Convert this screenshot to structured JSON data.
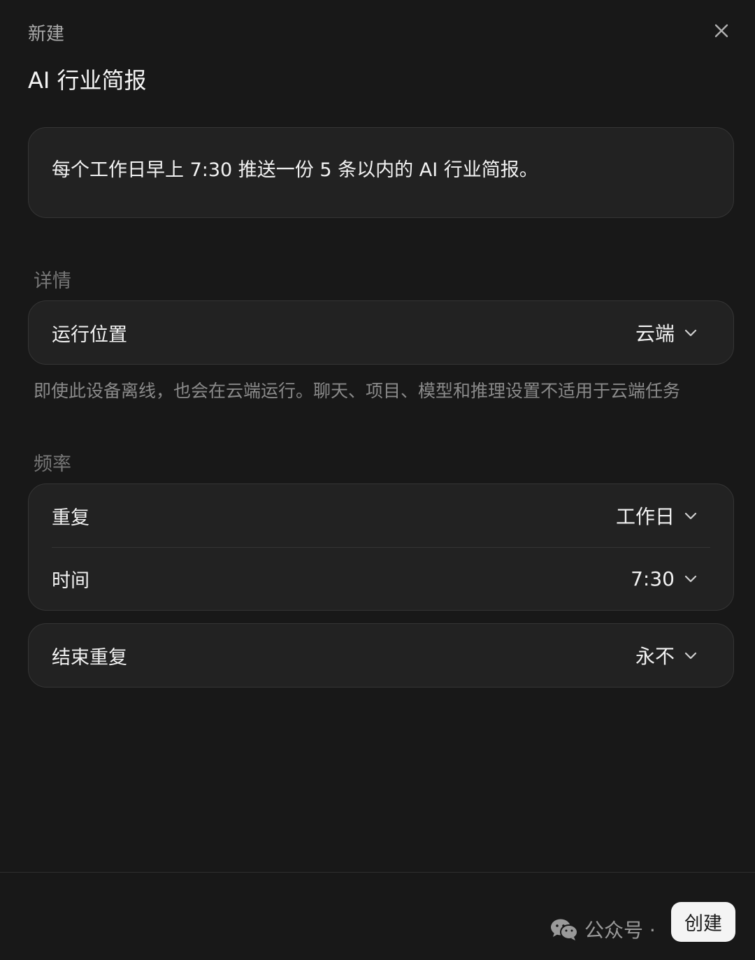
{
  "header": {
    "label": "新建",
    "close_icon": "close-icon"
  },
  "task": {
    "title": "AI 行业简报",
    "prompt": "每个工作日早上 7:30 推送一份 5 条以内的 AI 行业简报。"
  },
  "details": {
    "section_label": "详情",
    "location_label": "运行位置",
    "location_value": "云端",
    "hint": "即使此设备离线，也会在云端运行。聊天、项目、模型和推理设置不适用于云端任务"
  },
  "frequency": {
    "section_label": "频率",
    "repeat_label": "重复",
    "repeat_value": "工作日",
    "time_label": "时间",
    "time_value": "7:30",
    "end_label": "结束重复",
    "end_value": "永不"
  },
  "footer": {
    "watermark_text": "公众号 ·",
    "create_label": "创建"
  },
  "colors": {
    "background": "#181818",
    "card": "#222222",
    "border": "#353535",
    "button": "#f4f4f4"
  }
}
